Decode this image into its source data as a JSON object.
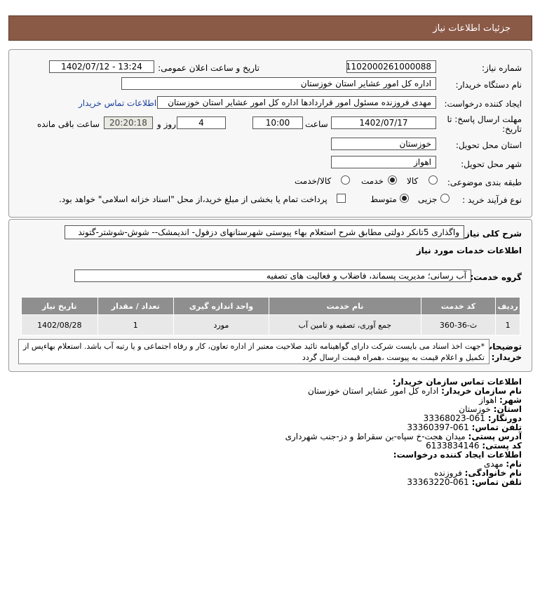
{
  "header": {
    "title": "جزئیات اطلاعات نیاز"
  },
  "form": {
    "need_number_label": "شماره نیاز:",
    "need_number": "1102000261000088",
    "announce_label": "تاریخ و ساعت اعلان عمومی:",
    "announce_value": "1402/07/12 - 13:24",
    "buyer_org_label": "نام دستگاه خریدار:",
    "buyer_org": "اداره کل امور عشایر استان خوزستان",
    "creator_label": "ایجاد کننده درخواست:",
    "creator": "مهدی فروزنده مسئول امور قراردادها اداره کل امور عشایر استان خوزستان",
    "buyer_contact_link": "اطلاعات تماس خریدار",
    "deadline_label": "مهلت ارسال پاسخ: تا تاریخ:",
    "deadline_date": "1402/07/17",
    "time_label": "ساعت",
    "deadline_time": "10:00",
    "days_value": "4",
    "days_label": "روز و",
    "remaining_time": "20:20:18",
    "remaining_label": "ساعت باقی مانده",
    "province_label": "استان محل تحویل:",
    "province": "خوزستان",
    "city_label": "شهر محل تحویل:",
    "city": "اهواز",
    "category_label": "طبقه بندی موضوعی:",
    "category_options": [
      "کالا",
      "خدمت",
      "کالا/خدمت"
    ],
    "process_label": "نوع فرآیند خرید :",
    "process_options": [
      "جزیی",
      "متوسط"
    ],
    "payment_note": "پرداخت تمام یا بخشی از مبلغ خرید،از محل \"اسناد خزانه اسلامی\" خواهد بود."
  },
  "summary": {
    "label": "شرح کلی نیاز:",
    "text": "واگذاری 5تانکر دولتی مطابق شرح استعلام بهاء پیوستی شهرستانهای دزفول- اندیمشک-- شوش-شوشتر-گتوند"
  },
  "services": {
    "section_title": "اطلاعات خدمات مورد نیاز",
    "group_label": "گروه خدمت:",
    "group_value": "آب رسانی؛ مدیریت پسماند، فاضلاب و فعالیت های تصفیه"
  },
  "table": {
    "headers": [
      "ردیف",
      "کد خدمت",
      "نام خدمت",
      "واحد اندازه گیری",
      "تعداد / مقدار",
      "تاریخ نیاز"
    ],
    "rows": [
      [
        "1",
        "ث-36-360",
        "جمع آوری، تصفیه و تامین آب",
        "مورد",
        "1",
        "1402/08/28"
      ]
    ]
  },
  "notes": {
    "label": "توضیحات خریدار:",
    "text": "*جهت اخذ اسناد می بایست شرکت دارای گواهینامه تائید صلاحیت معتبر از اداره تعاون، کار و رفاه اجتماعی و یا رتبه آب باشد. استعلام بهاءپس از تکمیل و اعلام قیمت به پیوست ،همراه قیمت ارسال گردد"
  },
  "buyer_contact": {
    "title": "اطلاعات تماس سازمان خریدار:",
    "org_label": "نام سازمان خریدار:",
    "org": "اداره کل امور عشایر استان خوزستان",
    "city_label": "شهر:",
    "city": "اهواز",
    "province_label": "استان:",
    "province": "خوزستان",
    "fax_label": "دورنگار:",
    "fax": "061-33368023",
    "phone_label": "تلفن تماس:",
    "phone": "061-33360397",
    "address_label": "آدرس پستی:",
    "address": "میدان هجت-خ سپاه-بن سقراط و دز-جنب شهرداری",
    "postal_label": "کد پستی:",
    "postal": "6133834146"
  },
  "creator_contact": {
    "title": "اطلاعات ایجاد کننده درخواست:",
    "name_label": "نام:",
    "name": "مهدی",
    "family_label": "نام خانوادگی:",
    "family": "فروزنده",
    "phone_label": "تلفن تماس:",
    "phone": "061-33363220"
  }
}
